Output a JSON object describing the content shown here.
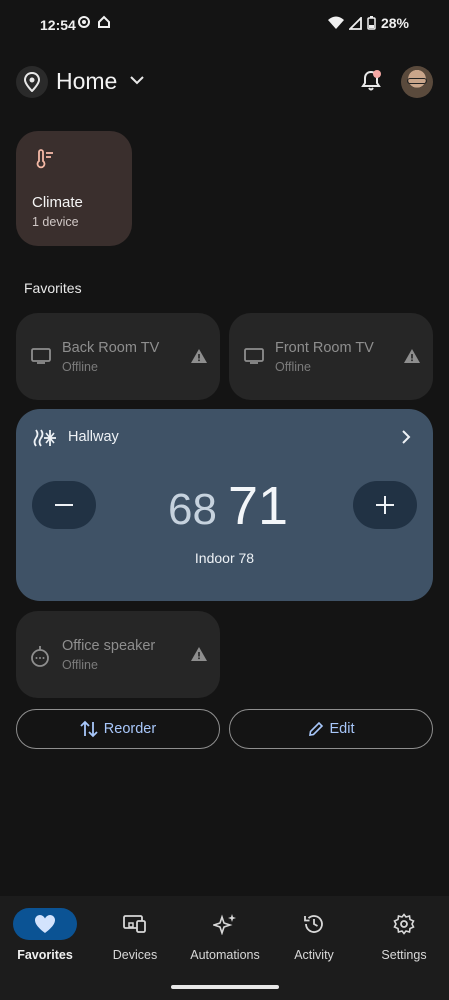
{
  "status_bar": {
    "time": "12:54",
    "battery": "28%"
  },
  "header": {
    "title": "Home"
  },
  "climate": {
    "title": "Climate",
    "subtitle": "1 device"
  },
  "favorites_label": "Favorites",
  "devices": [
    {
      "name": "Back Room TV",
      "status": "Offline",
      "icon": "tv-icon"
    },
    {
      "name": "Front Room TV",
      "status": "Offline",
      "icon": "tv-icon"
    },
    {
      "name": "Office speaker",
      "status": "Offline",
      "icon": "speaker-icon"
    }
  ],
  "thermostat": {
    "name": "Hallway",
    "setpoint": "68",
    "current": "71",
    "indoor": "Indoor 78"
  },
  "actions": {
    "reorder": "Reorder",
    "edit": "Edit"
  },
  "nav": [
    {
      "label": "Favorites",
      "icon": "heart-icon",
      "active": true
    },
    {
      "label": "Devices",
      "icon": "devices-icon",
      "active": false
    },
    {
      "label": "Automations",
      "icon": "sparkle-icon",
      "active": false
    },
    {
      "label": "Activity",
      "icon": "history-icon",
      "active": false
    },
    {
      "label": "Settings",
      "icon": "gear-icon",
      "active": false
    }
  ],
  "colors": {
    "background": "#141414",
    "thermostat": "#3f5266",
    "accent": "#a8c7fa",
    "nav_active": "#0b5394",
    "climate_tile": "#3a2f2d"
  }
}
